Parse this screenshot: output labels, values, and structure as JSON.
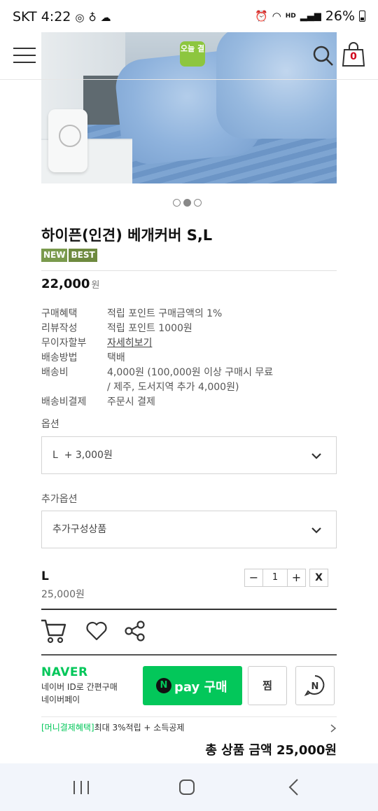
{
  "status_bar": {
    "carrier": "SKT",
    "time": "4:22",
    "battery": "26%",
    "volte": "HD Voice"
  },
  "header": {
    "logo_text": "오늘 결",
    "cart_count": "0"
  },
  "carousel": {
    "slide_count": 3,
    "active_index": 1
  },
  "product": {
    "title": "하이픈(인견) 베개커버 S,L",
    "badges": [
      "NEW",
      "BEST"
    ],
    "price": "22,000",
    "price_unit": "원"
  },
  "info_rows": [
    {
      "key": "구매혜택",
      "value": "적립 포인트 구매금액의 1%"
    },
    {
      "key": "리뷰작성",
      "value": "적립 포인트 1000원"
    },
    {
      "key": "무이자할부",
      "value": "자세히보기"
    },
    {
      "key": "배송방법",
      "value": "택배"
    },
    {
      "key": "배송비",
      "value": "4,000원 (100,000원 이상 구매시 무료",
      "value2": "/ 제주, 도서지역 추가 4,000원)"
    },
    {
      "key": "배송비결제",
      "value": "주문시 결제"
    }
  ],
  "options": {
    "label": "옵션",
    "selected": "L  + 3,000원",
    "extra_label": "추가옵션",
    "extra_selected": "추가구성상품"
  },
  "selected_item": {
    "name": "L",
    "price": "25,000원",
    "quantity": "1",
    "minus": "−",
    "plus": "+",
    "remove": "X"
  },
  "naver": {
    "logo": "NAVER",
    "line1": "네이버 ID로 간편구매",
    "line2": "네이버페이",
    "npay_n": "N",
    "npay_label": "pay 구매",
    "wish_label": "찜",
    "money_highlight": "[머니결제혜택]",
    "money_text": "최대 3%적립 + 소득공제"
  },
  "total": {
    "label": "총 상품 금액",
    "amount": "25,000원"
  }
}
